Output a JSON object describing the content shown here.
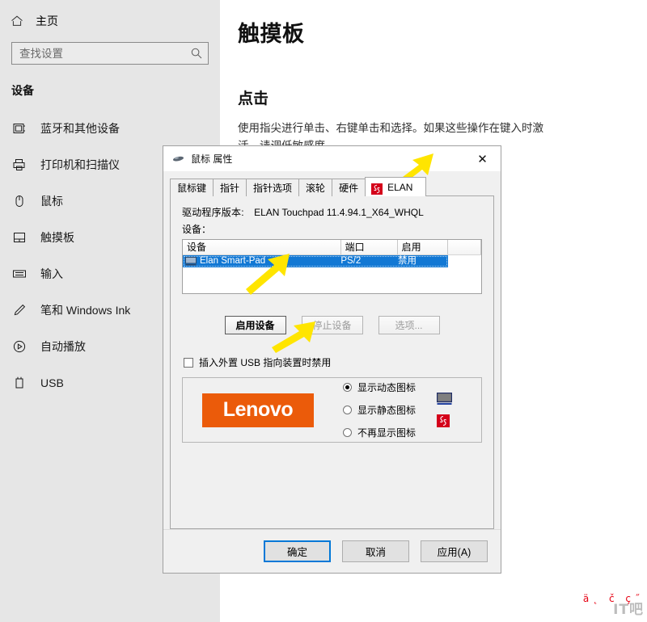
{
  "settings": {
    "home_label": "主页",
    "search": {
      "placeholder": "查找设置",
      "value": ""
    },
    "section_title": "设备",
    "nav_items": [
      {
        "label": "蓝牙和其他设备",
        "icon": "bluetooth-devices-icon"
      },
      {
        "label": "打印机和扫描仪",
        "icon": "printer-icon"
      },
      {
        "label": "鼠标",
        "icon": "mouse-icon"
      },
      {
        "label": "触摸板",
        "icon": "touchpad-icon"
      },
      {
        "label": "输入",
        "icon": "typing-icon"
      },
      {
        "label": "笔和 Windows Ink",
        "icon": "pen-icon"
      },
      {
        "label": "自动播放",
        "icon": "autoplay-icon"
      },
      {
        "label": "USB",
        "icon": "usb-icon"
      }
    ],
    "main": {
      "page_title": "触摸板",
      "section_heading": "点击",
      "description": "使用指尖进行单击、右键单击和选择。如果这些操作在键入时激活，请调低敏感度"
    }
  },
  "dialog": {
    "title": "鼠标 属性",
    "close_label": "✕",
    "tabs": [
      {
        "label": "鼠标键",
        "active": false
      },
      {
        "label": "指针",
        "active": false
      },
      {
        "label": "指针选项",
        "active": false
      },
      {
        "label": "滚轮",
        "active": false
      },
      {
        "label": "硬件",
        "active": false
      },
      {
        "label": "ELAN",
        "active": true,
        "icon": "elan-logo-icon"
      }
    ],
    "driver": {
      "label": "驱动程序版本:",
      "value": "ELAN Touchpad 11.4.94.1_X64_WHQL"
    },
    "devices_label": "设备：",
    "table": {
      "headers": [
        "设备",
        "端口",
        "启用",
        ""
      ],
      "rows": [
        {
          "device": "Elan Smart-Pad",
          "port": "PS/2",
          "enabled": "禁用",
          "selected": true
        }
      ]
    },
    "action_buttons": [
      {
        "label": "启用设备",
        "state": "default"
      },
      {
        "label": "停止设备",
        "state": "disabled"
      },
      {
        "label": "选项...",
        "state": "disabled"
      }
    ],
    "usb_checkbox": {
      "label": "插入外置 USB 指向装置时禁用",
      "checked": false
    },
    "brand": {
      "logo_text": "Lenovo",
      "logo_color": "#eb5b0a",
      "radios": [
        {
          "label": "显示动态图标",
          "selected": true,
          "icon": "monitor-icon"
        },
        {
          "label": "显示静态图标",
          "selected": false,
          "icon": "elan-logo-icon"
        },
        {
          "label": "不再显示图标",
          "selected": false,
          "icon": ""
        }
      ]
    },
    "footer_buttons": [
      {
        "label": "确定",
        "default": true
      },
      {
        "label": "取消",
        "default": false
      },
      {
        "label": "应用(A)",
        "default": false
      }
    ]
  },
  "annotations": {
    "arrow_color": "#ffe500",
    "arrows": [
      "arrow-to-elan-tab",
      "arrow-to-device-row",
      "arrow-to-enable-button"
    ]
  },
  "watermark": {
    "red_text": "ä˛ č ç˝",
    "gray_text": "IT吧"
  }
}
